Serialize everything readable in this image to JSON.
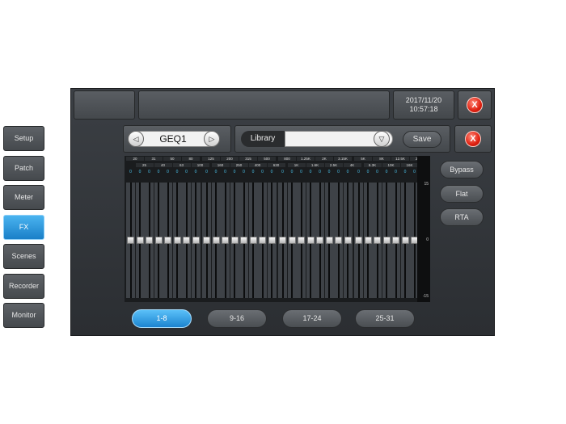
{
  "header": {
    "date": "2017/11/20",
    "time": "10:57:18",
    "close_label": "X"
  },
  "sidebar": {
    "items": [
      {
        "label": "Setup",
        "active": false
      },
      {
        "label": "Patch",
        "active": false
      },
      {
        "label": "Meter",
        "active": false
      },
      {
        "label": "FX",
        "active": true
      },
      {
        "label": "Scenes",
        "active": false
      },
      {
        "label": "Recorder",
        "active": false
      },
      {
        "label": "Monitor",
        "active": false
      }
    ]
  },
  "geq": {
    "name": "GEQ1",
    "library_label": "Library",
    "library_value": "",
    "save_label": "Save",
    "close_label": "X",
    "row1": [
      "20",
      "31",
      "50",
      "80",
      "125",
      "200",
      "315",
      "500",
      "800",
      "1.25K",
      "2K",
      "3.15K",
      "5K",
      "8K",
      "12.5K",
      "20K"
    ],
    "row2": [
      "25",
      "40",
      "63",
      "100",
      "160",
      "250",
      "400",
      "630",
      "1K",
      "1.6K",
      "2.5K",
      "4K",
      "6.3K",
      "10K",
      "16K"
    ],
    "gain_value": "0",
    "scale": [
      "15",
      "0",
      "-15"
    ]
  },
  "right_buttons": {
    "bypass": "Bypass",
    "flat": "Flat",
    "rta": "RTA"
  },
  "banks": [
    "1-8",
    "9-16",
    "17-24",
    "25-31"
  ]
}
